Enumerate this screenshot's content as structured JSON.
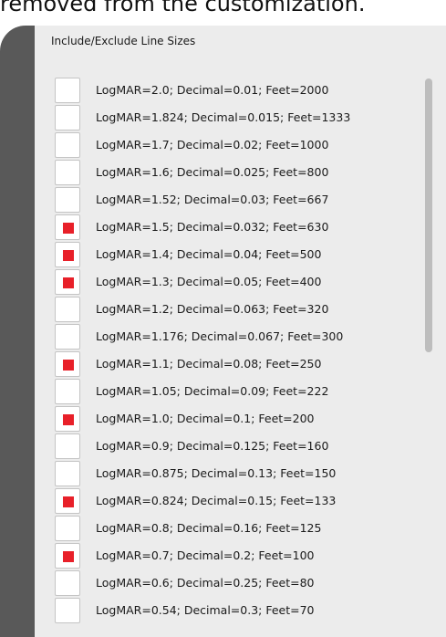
{
  "caption": "removed from the customization.",
  "section": {
    "title": "Include/Exclude Line Sizes"
  },
  "items": [
    {
      "label": "LogMAR=2.0; Decimal=0.01; Feet=2000",
      "checked": false
    },
    {
      "label": "LogMAR=1.824; Decimal=0.015; Feet=1333",
      "checked": false
    },
    {
      "label": "LogMAR=1.7; Decimal=0.02; Feet=1000",
      "checked": false
    },
    {
      "label": "LogMAR=1.6; Decimal=0.025; Feet=800",
      "checked": false
    },
    {
      "label": "LogMAR=1.52; Decimal=0.03; Feet=667",
      "checked": false
    },
    {
      "label": "LogMAR=1.5; Decimal=0.032; Feet=630",
      "checked": true
    },
    {
      "label": "LogMAR=1.4; Decimal=0.04; Feet=500",
      "checked": true
    },
    {
      "label": "LogMAR=1.3; Decimal=0.05; Feet=400",
      "checked": true
    },
    {
      "label": "LogMAR=1.2; Decimal=0.063; Feet=320",
      "checked": false
    },
    {
      "label": "LogMAR=1.176; Decimal=0.067; Feet=300",
      "checked": false
    },
    {
      "label": "LogMAR=1.1; Decimal=0.08; Feet=250",
      "checked": true
    },
    {
      "label": "LogMAR=1.05; Decimal=0.09; Feet=222",
      "checked": false
    },
    {
      "label": "LogMAR=1.0; Decimal=0.1; Feet=200",
      "checked": true
    },
    {
      "label": "LogMAR=0.9; Decimal=0.125; Feet=160",
      "checked": false
    },
    {
      "label": "LogMAR=0.875; Decimal=0.13; Feet=150",
      "checked": false
    },
    {
      "label": "LogMAR=0.824; Decimal=0.15; Feet=133",
      "checked": true
    },
    {
      "label": "LogMAR=0.8; Decimal=0.16; Feet=125",
      "checked": false
    },
    {
      "label": "LogMAR=0.7; Decimal=0.2; Feet=100",
      "checked": true
    },
    {
      "label": "LogMAR=0.6; Decimal=0.25; Feet=80",
      "checked": false
    },
    {
      "label": "LogMAR=0.54; Decimal=0.3; Feet=70",
      "checked": false
    }
  ],
  "colors": {
    "check_mark": "#e82029",
    "panel_bg": "#ececec",
    "sidebar": "#595959",
    "scrollbar_thumb": "#bdbdbd"
  }
}
